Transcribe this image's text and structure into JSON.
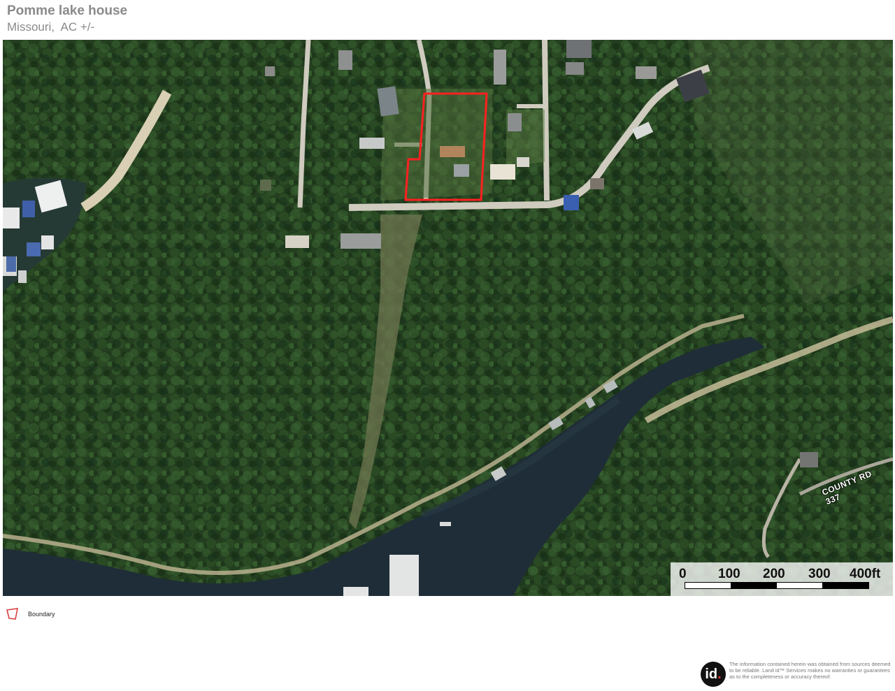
{
  "header": {
    "title": "Pomme lake house",
    "subtitle": "Missouri,  AC +/-"
  },
  "map": {
    "type": "satellite",
    "boundary_color": "#ff2020",
    "road_label": "COUNTY RD 337",
    "scale": {
      "labels": [
        "0",
        "100",
        "200",
        "300",
        "400ft"
      ],
      "unit": "ft"
    }
  },
  "legend": {
    "items": [
      {
        "label": "Boundary",
        "color": "#d94040",
        "icon": "boundary-polygon-icon"
      }
    ]
  },
  "branding": {
    "logo_text": "id",
    "logo_dot": ".",
    "disclaimer": "The information contained herein was obtained from sources deemed to be reliable. Land id™ Services makes no warranties or guarantees as to the completeness or accuracy thereof."
  }
}
